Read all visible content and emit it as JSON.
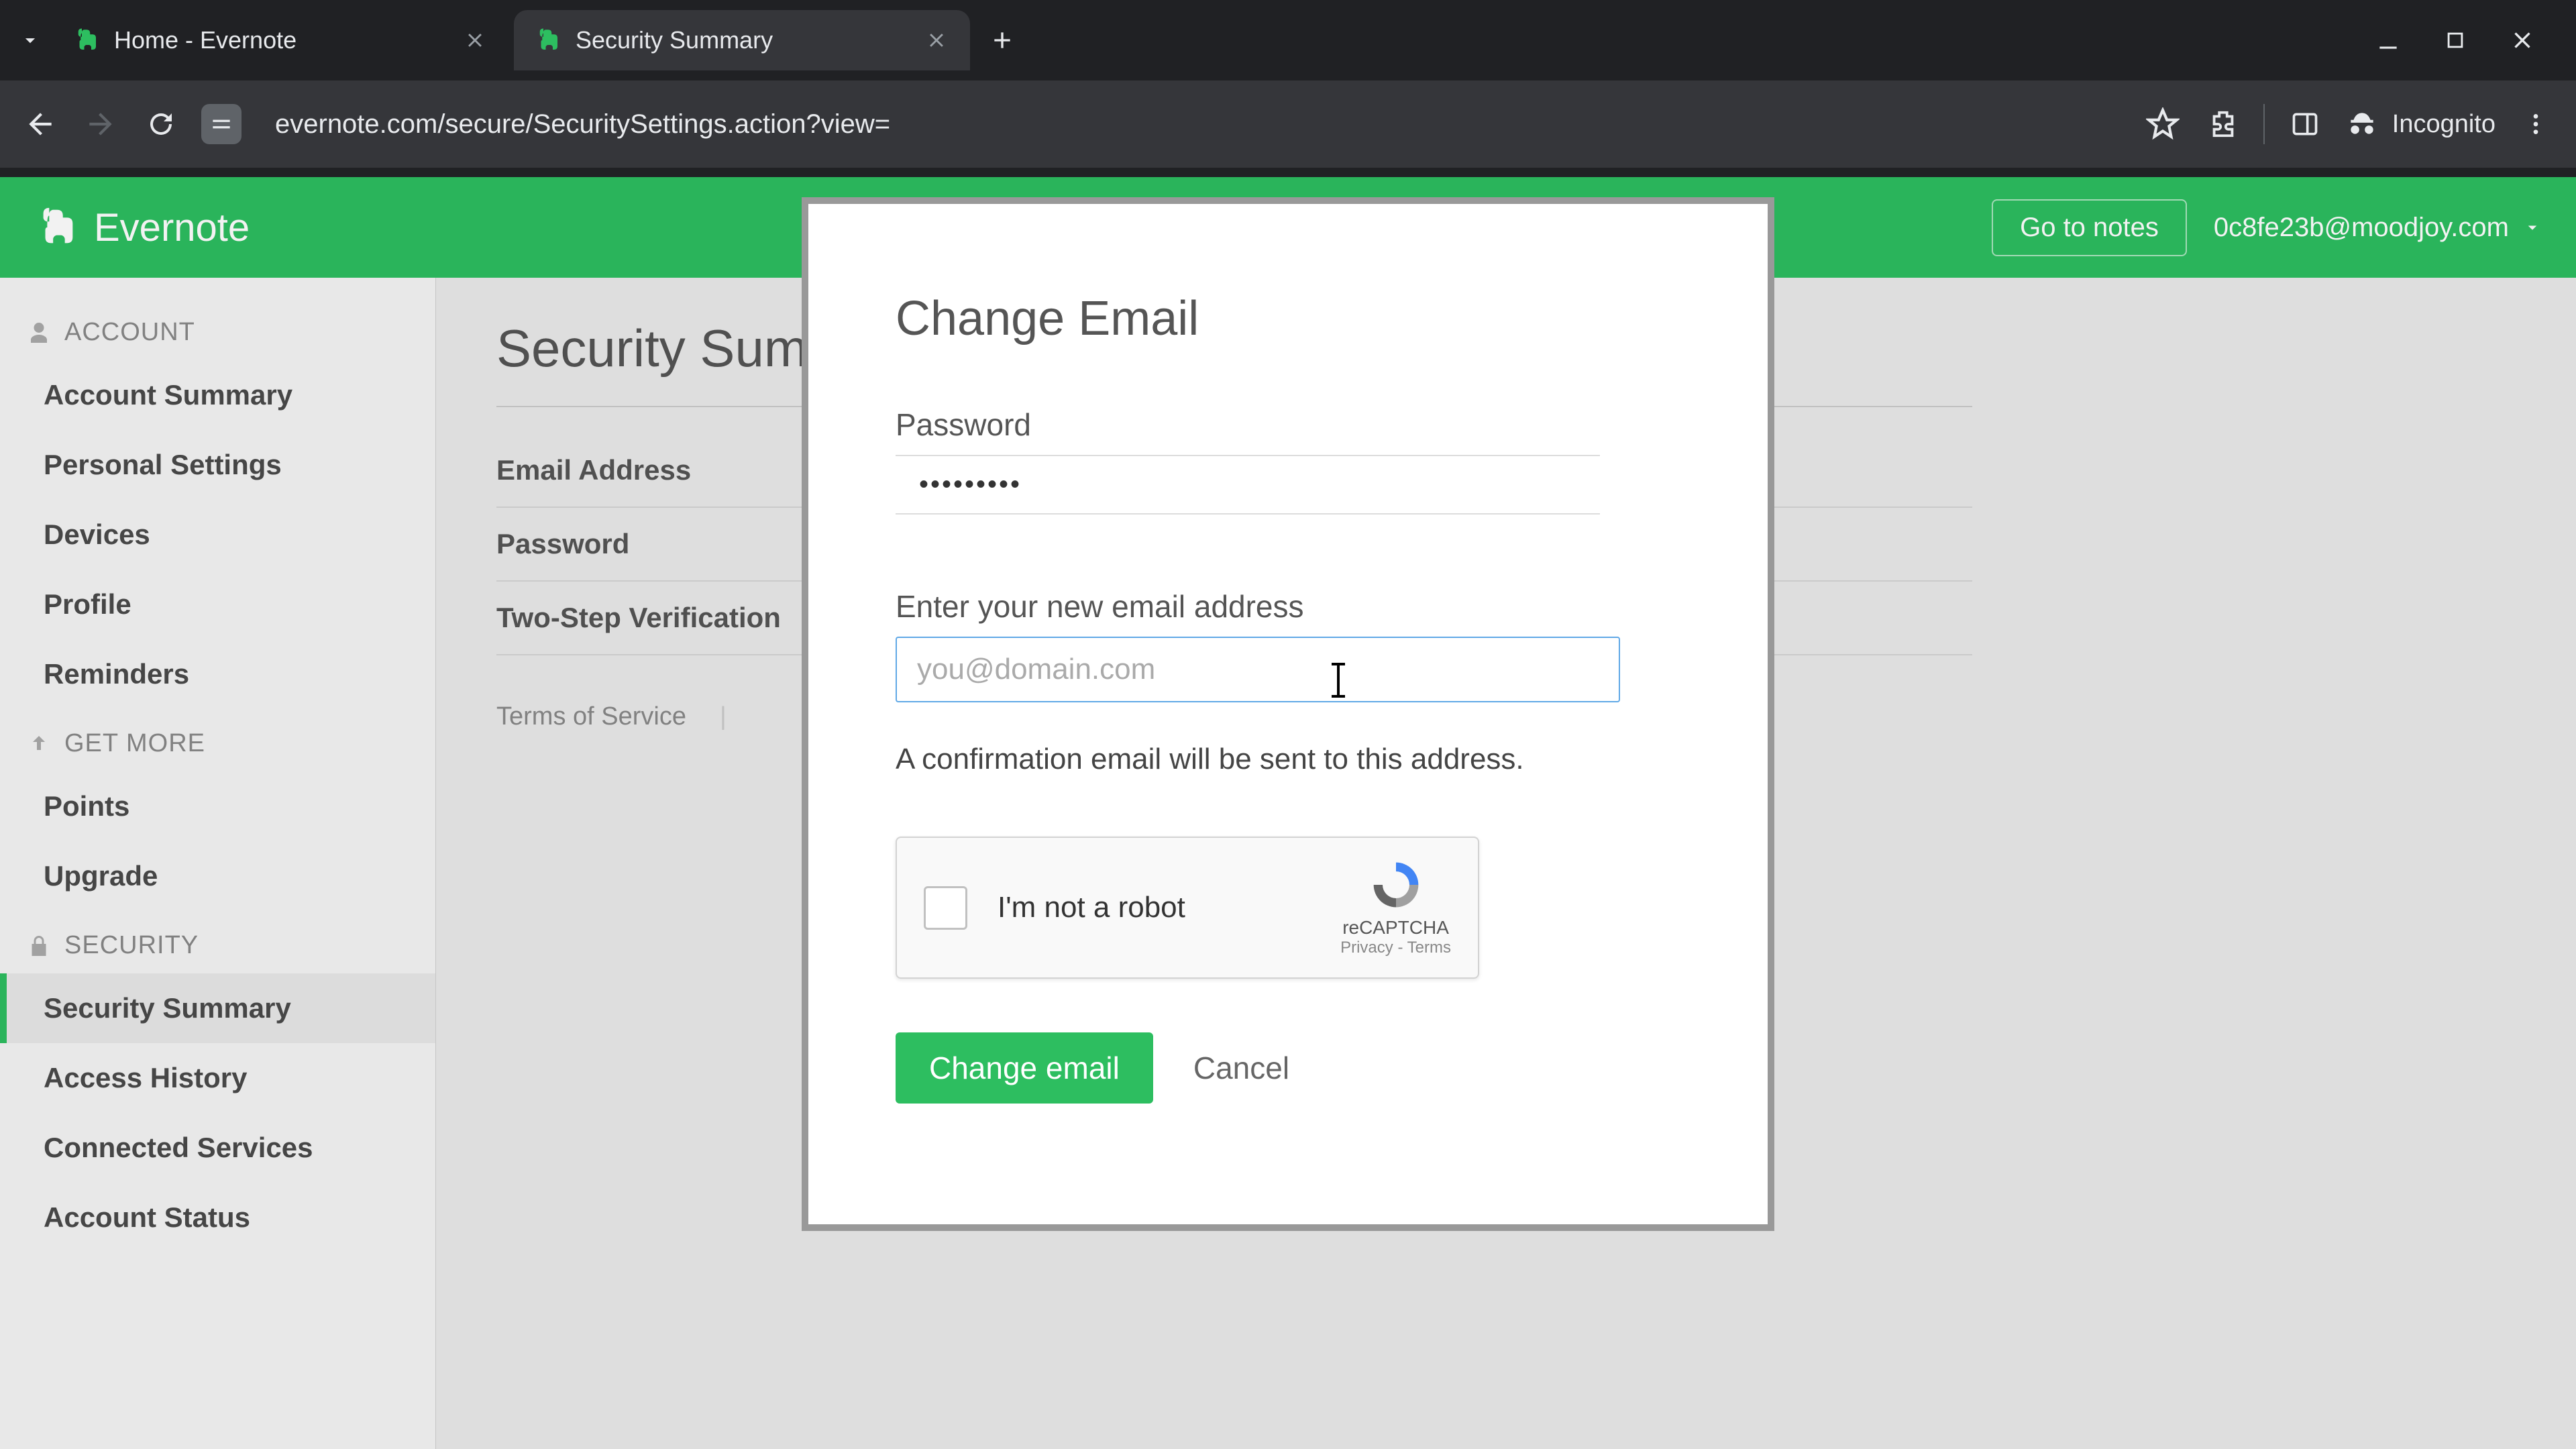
{
  "browser": {
    "tabs": [
      {
        "title": "Home - Evernote",
        "active": false
      },
      {
        "title": "Security Summary",
        "active": true
      }
    ],
    "url": "evernote.com/secure/SecuritySettings.action?view=",
    "incognito_label": "Incognito"
  },
  "header": {
    "brand": "Evernote",
    "go_to_notes": "Go to notes",
    "user_email": "0c8fe23b@moodjoy.com"
  },
  "sidebar": {
    "sections": [
      {
        "label": "ACCOUNT",
        "icon": "user",
        "items": [
          "Account Summary",
          "Personal Settings",
          "Devices",
          "Profile",
          "Reminders"
        ]
      },
      {
        "label": "GET MORE",
        "icon": "arrow-up",
        "items": [
          "Points",
          "Upgrade"
        ]
      },
      {
        "label": "SECURITY",
        "icon": "lock",
        "items": [
          "Security Summary",
          "Access History",
          "Connected Services",
          "Account Status"
        ],
        "active_index": 0
      }
    ]
  },
  "content": {
    "title": "Security Summary",
    "rows": [
      "Email Address",
      "Password",
      "Two-Step Verification"
    ],
    "footer": {
      "terms": "Terms of Service"
    }
  },
  "modal": {
    "title": "Change Email",
    "password_label": "Password",
    "password_masked": "•••••••••",
    "email_label": "Enter your new email address",
    "email_placeholder": "you@domain.com",
    "email_value": "",
    "helper": "A confirmation email will be sent to this address.",
    "recaptcha": {
      "label": "I'm not a robot",
      "brand": "reCAPTCHA",
      "links": "Privacy - Terms"
    },
    "actions": {
      "primary": "Change email",
      "cancel": "Cancel"
    }
  }
}
